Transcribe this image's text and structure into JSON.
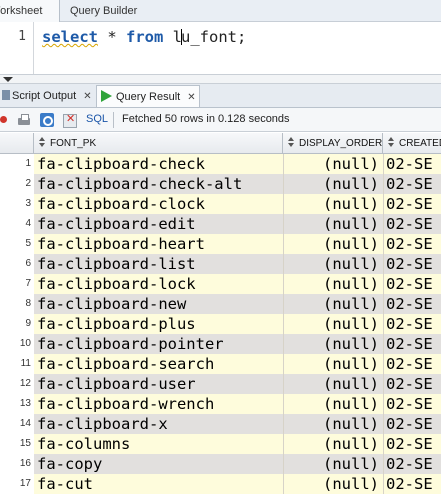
{
  "top_tabs": {
    "worksheet": "Worksheet",
    "query_builder": "Query Builder"
  },
  "editor": {
    "line_number": "1",
    "kw_select": "select",
    "star": " * ",
    "kw_from": "from",
    "table_before_caret": " l",
    "table_after_caret": "u_font;"
  },
  "bottom_tabs": {
    "script_output": "Script Output",
    "query_result": "Query Result"
  },
  "toolbar": {
    "sql_label": "SQL",
    "status": "Fetched 50 rows in 0.128 seconds"
  },
  "grid": {
    "headers": {
      "font_pk": "FONT_PK",
      "display_order": "DISPLAY_ORDER",
      "created": "CREATED"
    },
    "rows": [
      {
        "n": "1",
        "font_pk": "fa-clipboard-check",
        "display_order": "(null)",
        "created": "02-SE"
      },
      {
        "n": "2",
        "font_pk": "fa-clipboard-check-alt",
        "display_order": "(null)",
        "created": "02-SE"
      },
      {
        "n": "3",
        "font_pk": "fa-clipboard-clock",
        "display_order": "(null)",
        "created": "02-SE"
      },
      {
        "n": "4",
        "font_pk": "fa-clipboard-edit",
        "display_order": "(null)",
        "created": "02-SE"
      },
      {
        "n": "5",
        "font_pk": "fa-clipboard-heart",
        "display_order": "(null)",
        "created": "02-SE"
      },
      {
        "n": "6",
        "font_pk": "fa-clipboard-list",
        "display_order": "(null)",
        "created": "02-SE"
      },
      {
        "n": "7",
        "font_pk": "fa-clipboard-lock",
        "display_order": "(null)",
        "created": "02-SE"
      },
      {
        "n": "8",
        "font_pk": "fa-clipboard-new",
        "display_order": "(null)",
        "created": "02-SE"
      },
      {
        "n": "9",
        "font_pk": "fa-clipboard-plus",
        "display_order": "(null)",
        "created": "02-SE"
      },
      {
        "n": "10",
        "font_pk": "fa-clipboard-pointer",
        "display_order": "(null)",
        "created": "02-SE"
      },
      {
        "n": "11",
        "font_pk": "fa-clipboard-search",
        "display_order": "(null)",
        "created": "02-SE"
      },
      {
        "n": "12",
        "font_pk": "fa-clipboard-user",
        "display_order": "(null)",
        "created": "02-SE"
      },
      {
        "n": "13",
        "font_pk": "fa-clipboard-wrench",
        "display_order": "(null)",
        "created": "02-SE"
      },
      {
        "n": "14",
        "font_pk": "fa-clipboard-x",
        "display_order": "(null)",
        "created": "02-SE"
      },
      {
        "n": "15",
        "font_pk": "fa-columns",
        "display_order": "(null)",
        "created": "02-SE"
      },
      {
        "n": "16",
        "font_pk": "fa-copy",
        "display_order": "(null)",
        "created": "02-SE"
      },
      {
        "n": "17",
        "font_pk": "fa-cut",
        "display_order": "(null)",
        "created": "02-SE"
      }
    ]
  }
}
